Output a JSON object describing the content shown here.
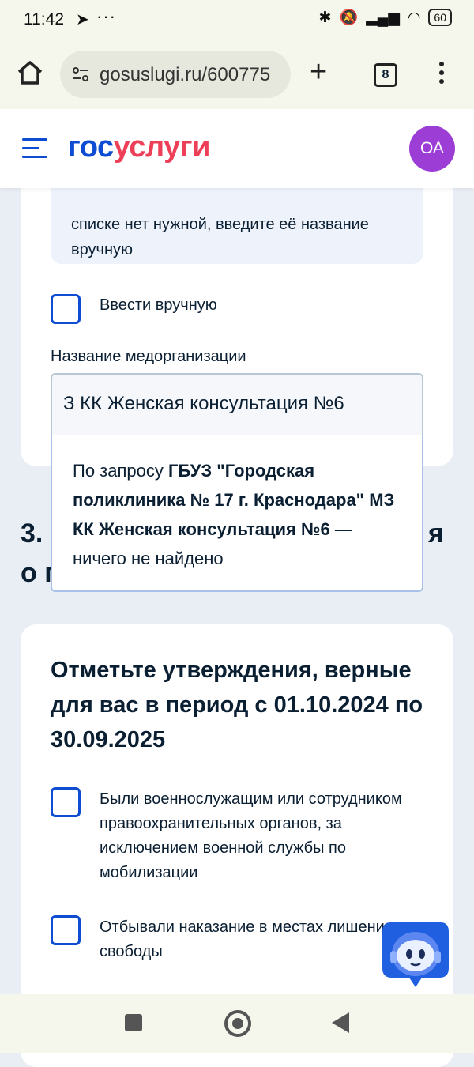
{
  "status_bar": {
    "time": "11:42",
    "battery": "60"
  },
  "browser": {
    "url": "gosuslugi.ru/600775",
    "tab_count": "8"
  },
  "site_header": {
    "logo_part1": "гос",
    "logo_part2": "услуги",
    "avatar_initials": "ОА",
    "brand_blue": "#0d4cd3",
    "brand_red": "#ee3f58"
  },
  "form": {
    "hint_text": "списке нет нужной, введите её название вручную",
    "manual_entry_label": "Ввести вручную",
    "field_label": "Название медорганизации",
    "field_value": "З КК Женская консультация №6",
    "dropdown": {
      "prefix": "По запросу ",
      "query": "ГБУЗ \"Городская поликлиника № 17 г. Краснодара\" МЗ КК Женская консультация №6",
      "suffix": " — ничего не найдено"
    }
  },
  "section3": {
    "title_fragment": "3.                                             я\nо г"
  },
  "statements_card": {
    "title": "Отметьте утверждения, верные для вас в период с 01.10.2024 по 30.09.2025",
    "options": [
      {
        "label": "Были военнослужащим или сотрудником правоохранительных органов, за исключением военной службы по мобилизации",
        "checked": false
      },
      {
        "label": "Отбывали наказание в местах лишения свободы",
        "checked": false
      }
    ]
  }
}
